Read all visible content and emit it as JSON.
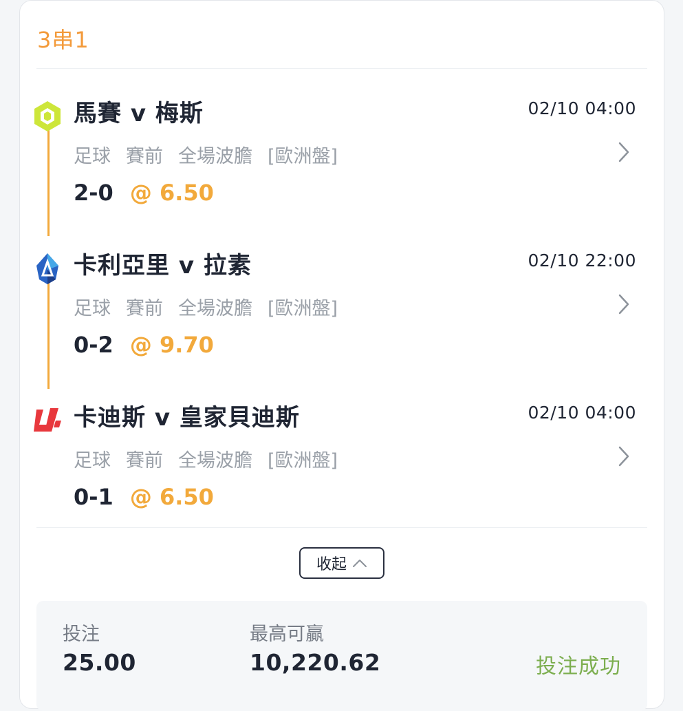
{
  "bet": {
    "type_label": "3串1",
    "legs": [
      {
        "icon": "ligue1-league-icon",
        "match": "馬賽 v 梅斯",
        "time": "02/10 04:00",
        "sport": "足球",
        "phase": "賽前",
        "market": "全場波膽",
        "odds_format": "[歐洲盤]",
        "selection": "2-0",
        "odds": "@ 6.50"
      },
      {
        "icon": "serie-a-league-icon",
        "match": "卡利亞里 v 拉素",
        "time": "02/10 22:00",
        "sport": "足球",
        "phase": "賽前",
        "market": "全場波膽",
        "odds_format": "[歐洲盤]",
        "selection": "0-2",
        "odds": "@ 9.70"
      },
      {
        "icon": "laliga-league-icon",
        "match": "卡迪斯 v 皇家貝迪斯",
        "time": "02/10 04:00",
        "sport": "足球",
        "phase": "賽前",
        "market": "全場波膽",
        "odds_format": "[歐洲盤]",
        "selection": "0-1",
        "odds": "@ 6.50"
      }
    ],
    "collapse_label": "收起",
    "summary": {
      "stake_label": "投注",
      "stake_value": "25.00",
      "max_win_label": "最高可贏",
      "max_win_value": "10,220.62",
      "status": "投注成功"
    }
  },
  "colors": {
    "accent": "#f2a93b",
    "title_orange": "#f39a3a",
    "success_green": "#7cae4f",
    "text_dark": "#1f2533",
    "text_muted": "#9aa0a8"
  }
}
